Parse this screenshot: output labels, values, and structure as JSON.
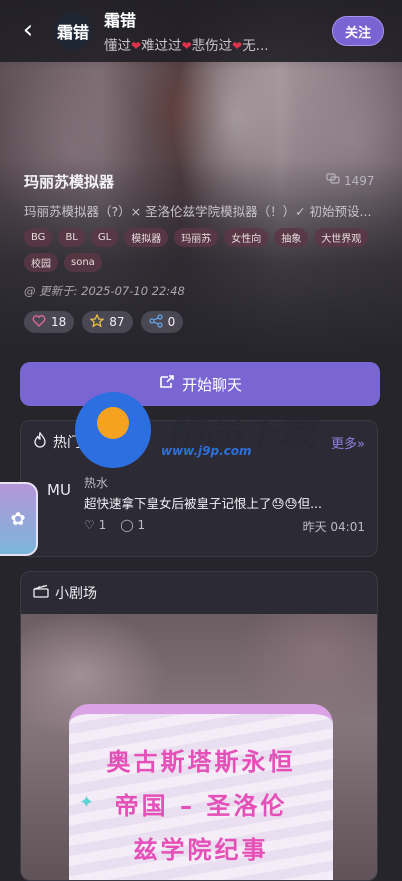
{
  "header": {
    "character_name": "霜错",
    "avatar_text": "霜错",
    "tagline_parts": [
      "懂过",
      "难过过",
      "悲伤过",
      "无..."
    ],
    "follow_label": "关注"
  },
  "work": {
    "title": "玛丽苏模拟器",
    "chat_count": "1497",
    "description": "玛丽苏模拟器（?）× 圣洛伦兹学院模拟器（！）✓ 初始预设...",
    "tags": [
      "BG",
      "BL",
      "GL",
      "模拟器",
      "玛丽苏",
      "女性向",
      "抽象",
      "大世界观",
      "校园",
      "sona"
    ],
    "updated": "@ 更新于: 2025-07-10 22:48",
    "likes": "18",
    "stars": "87",
    "shares": "0"
  },
  "start_chat_label": "开始聊天",
  "hot_comments": {
    "title": "热门评论",
    "more_label": "更多»",
    "post": {
      "avatar": "MU",
      "user": "热水",
      "text": "超快速拿下皇女后被皇子记恨上了😓😓但...",
      "likes": "1",
      "comments": "1",
      "time": "昨天 04:01"
    }
  },
  "theater": {
    "title": "小剧场",
    "poster_lines": [
      "奥古斯塔斯永恒",
      "帝国 – 圣洛伦",
      "兹学院纪事"
    ]
  },
  "watermark": {
    "brand": "精品下载",
    "url": "www.j9p.com"
  },
  "colors": {
    "accent": "#7a66d2",
    "heart": "#e0334a",
    "tag_bg": "#5a3744",
    "poster_text": "#e54fb8"
  }
}
